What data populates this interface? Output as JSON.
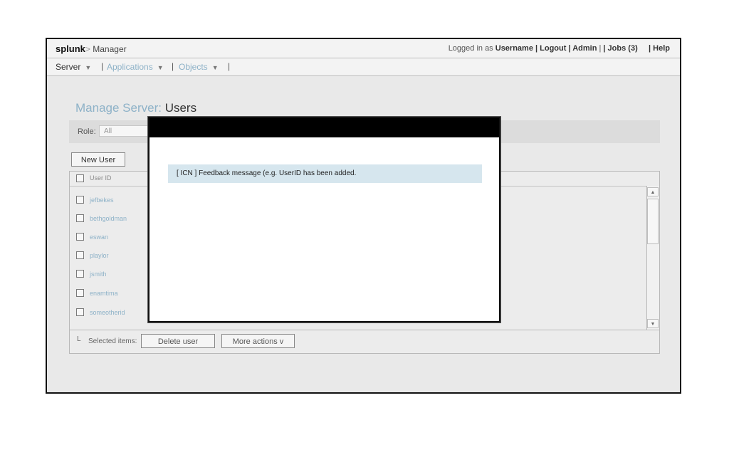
{
  "header": {
    "logo": "splunk",
    "separator": ">",
    "section": "Manager",
    "logged_in_as": "Logged in as",
    "username": "Username",
    "links": [
      "| Logout",
      "| Admin",
      "| Jobs (3)",
      "| Help"
    ],
    "pipe": "|"
  },
  "nav": {
    "items": [
      "Server",
      "Applications",
      "Objects"
    ],
    "caret": "▼",
    "pipe": "|"
  },
  "page": {
    "title_prefix": "Manage Server:",
    "title": "Users"
  },
  "filter": {
    "role_label": "Role:",
    "role_value": "All"
  },
  "new_user_button": "New User",
  "table": {
    "column_header": "User ID",
    "rows": [
      "jefbekes",
      "bethgoldman",
      "eswan",
      "playlor",
      "jsmith",
      "enamtima",
      "someotherid"
    ]
  },
  "scrollbar": {
    "up": "▲",
    "down": "▼"
  },
  "footer": {
    "corner": "L",
    "selected_label": "Selected items:",
    "delete_button": "Delete user",
    "more_actions_button": "More actions v"
  },
  "modal": {
    "message": "[ ICN ] Feedback message (e.g. UserID has been added."
  },
  "colors": {
    "accent": "#8eb2c8",
    "feedback_bg": "#d6e6ee",
    "modal_header": "#000000"
  }
}
